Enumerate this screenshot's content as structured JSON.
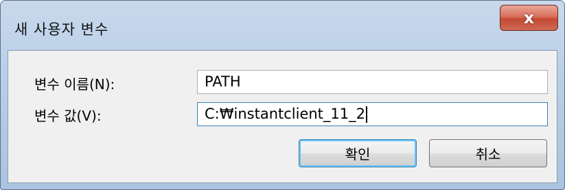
{
  "window": {
    "title": "새 사용자 변수",
    "close_glyph": "x"
  },
  "form": {
    "name_label": "변수 이름(N):",
    "name_value": "PATH",
    "value_label": "변수 값(V):",
    "value_value": "C:₩instantclient_11_2"
  },
  "buttons": {
    "ok_label": "확인",
    "cancel_label": "취소"
  }
}
